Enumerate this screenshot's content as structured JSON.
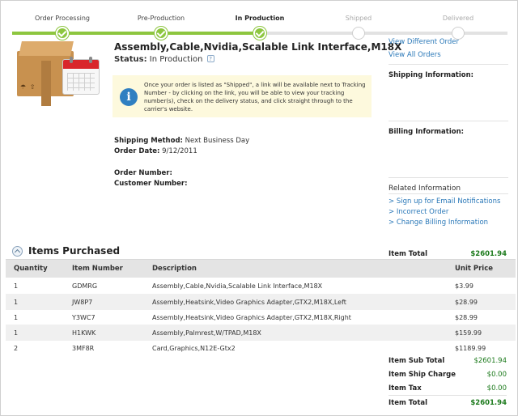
{
  "progress": {
    "steps": [
      {
        "label": "Order Processing",
        "state": "done"
      },
      {
        "label": "Pre-Production",
        "state": "done"
      },
      {
        "label": "In Production",
        "state": "current"
      },
      {
        "label": "Shipped",
        "state": "todo"
      },
      {
        "label": "Delivered",
        "state": "todo"
      }
    ]
  },
  "order": {
    "title": "Assembly,Cable,Nvidia,Scalable Link Interface,M18X",
    "status_label": "Status:",
    "status_value": "In Production",
    "notice": "Once your order is listed as \"Shipped\", a link will be available next to Tracking Number - by clicking on the link, you will be able to view your tracking number(s), check on the delivery status, and click straight through to the carrier's website.",
    "shipping_method_label": "Shipping Method:",
    "shipping_method_value": "Next Business Day",
    "order_date_label": "Order Date:",
    "order_date_value": "9/12/2011",
    "order_number_label": "Order Number:",
    "customer_number_label": "Customer Number:"
  },
  "sidebar": {
    "links": [
      "View Different Order",
      "View All Orders"
    ],
    "shipping_info_label": "Shipping Information:",
    "billing_info_label": "Billing Information:",
    "related_title": "Related Information",
    "related_links": [
      "> Sign up for Email Notifications",
      "> Incorrect Order",
      "> Change Billing Information"
    ],
    "item_total_label": "Item Total",
    "item_total_value": "$2601.94"
  },
  "items": {
    "section_title": "Items Purchased",
    "columns": [
      "Quantity",
      "Item Number",
      "Description",
      "Unit Price"
    ],
    "rows": [
      [
        "1",
        "GDMRG",
        "Assembly,Cable,Nvidia,Scalable Link Interface,M18X",
        "$3.99"
      ],
      [
        "1",
        "JW8P7",
        "Assembly,Heatsink,Video Graphics Adapter,GTX2,M18X,Left",
        "$28.99"
      ],
      [
        "1",
        "Y3WC7",
        "Assembly,Heatsink,Video Graphics Adapter,GTX2,M18X,Right",
        "$28.99"
      ],
      [
        "1",
        "H1KWK",
        "Assembly,Palmrest,W/TPAD,M18X",
        "$159.99"
      ],
      [
        "2",
        "3MF8R",
        "Card,Graphics,N12E-Gtx2",
        "$1189.99"
      ]
    ]
  },
  "totals": [
    {
      "label": "Item Sub Total",
      "value": "$2601.94"
    },
    {
      "label": "Item Ship Charge",
      "value": "$0.00"
    },
    {
      "label": "Item Tax",
      "value": "$0.00"
    },
    {
      "label": "Item Total",
      "value": "$2601.94"
    }
  ],
  "colors": {
    "progress_done": "#8dc63f",
    "link": "#2a78b8",
    "money": "#1c7a1c",
    "notice_bg": "#fdf9dd"
  }
}
